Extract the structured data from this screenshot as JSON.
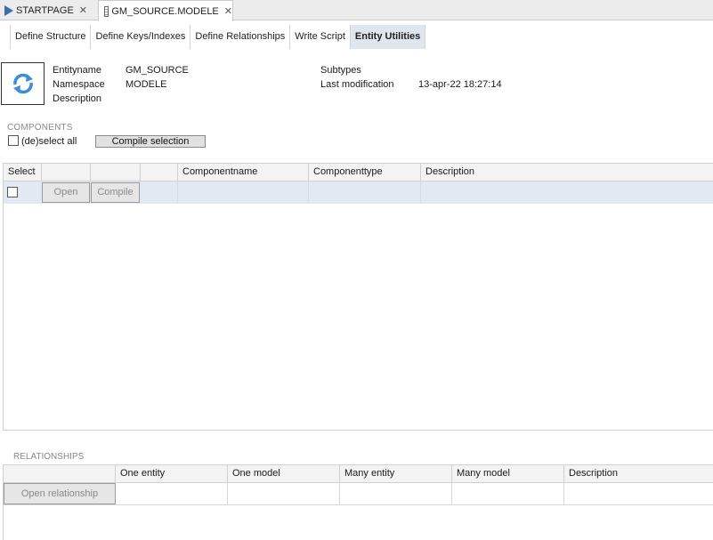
{
  "doc_tabs": [
    {
      "label": "STARTPAGE",
      "close": "✕",
      "icon": "play-icon"
    },
    {
      "label": "GM_SOURCE.MODELE",
      "close": "✕",
      "icon": "table-icon"
    }
  ],
  "sub_tabs": [
    "Define Structure",
    "Define Keys/Indexes",
    "Define Relationships",
    "Write Script",
    "Entity Utilities"
  ],
  "entity": {
    "entityname_label": "Entityname",
    "entityname_value": "GM_SOURCE",
    "namespace_label": "Namespace",
    "namespace_value": "MODELE",
    "description_label": "Description",
    "subtypes_label": "Subtypes",
    "last_mod_label": "Last modification",
    "last_mod_value": "13-apr-22 18:27:14"
  },
  "components": {
    "title": "COMPONENTS",
    "deselect_label": "(de)select all",
    "compile_selection": "Compile selection",
    "columns": [
      "Select",
      "",
      "",
      "",
      "Componentname",
      "Componenttype",
      "Description"
    ],
    "row": {
      "open": "Open",
      "compile": "Compile"
    }
  },
  "relationships": {
    "title": "RELATIONSHIPS",
    "columns": [
      "",
      "One entity",
      "One model",
      "Many entity",
      "Many model",
      "Description"
    ],
    "open_button": "Open relationship"
  },
  "colors": {
    "accent": "#3a8fd8",
    "active_tab": "#dfe6ee",
    "row_highlight": "#e3e9f3"
  }
}
